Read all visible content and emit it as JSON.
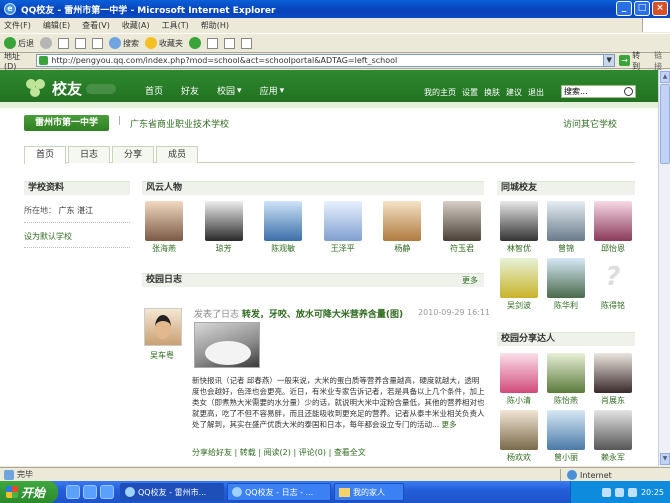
{
  "window": {
    "title": "QQ校友 - 雷州市第一中学 - Microsoft Internet Explorer",
    "menu": [
      "文件(F)",
      "编辑(E)",
      "查看(V)",
      "收藏(A)",
      "工具(T)",
      "帮助(H)"
    ],
    "toolbar": {
      "back": "后退",
      "search": "搜索",
      "favorites": "收藏夹"
    },
    "address_label": "地址(D)",
    "address_value": "http://pengyou.qq.com/index.php?mod=school&act=schoolportal&ADTAG=left_school",
    "go_label": "转到",
    "links_label": "链接"
  },
  "site": {
    "logo": "校友",
    "nav": [
      "首页",
      "好友",
      "校园",
      "应用"
    ],
    "user_links": [
      "我的主页",
      "设置",
      "换肤",
      "建议",
      "退出"
    ],
    "search_placeholder": "搜索..."
  },
  "school": {
    "name": "雷州市第一中学",
    "other": "广东省商业职业技术学校",
    "visit_other": "访问其它学校"
  },
  "tabs": [
    "首页",
    "日志",
    "分享",
    "成员"
  ],
  "school_info": {
    "title": "学校资料",
    "location_label": "所在地：",
    "location": "广东 湛江",
    "set_default": "设为默认学校"
  },
  "people": {
    "title": "风云人物",
    "items": [
      "张海燕",
      "琼芳",
      "陈观敏",
      "王泽平",
      "杨静",
      "符玉君"
    ]
  },
  "blog": {
    "title": "校园日志",
    "more": "更多",
    "author": "吴车粤",
    "action": "发表了日志",
    "post_title": "转发，牙咬、放水可降大米营养含量(图)",
    "time": "2010-09-29 16:11",
    "text": "新快报讯（记者 邱春燕）一般来说，大米的蛋白质等营养含量越高，硬度就越大，透明度也会越好，色泽也会更亮。近日，有米业专家告诉记者，若是具备以上几个条件，加上类女（即煮熟大米需要的水分量）少的话，就说明大米中淀粉含量低，其他的营养相对也就更高，吃了不但不容易胖，而且还能吸收到更充足的营养。记者从泰丰米业相关负责人处了解到，其实在盛产优质大米的泰国和日本，每年都会设立专门的活动...",
    "text_more": "更多",
    "actions": [
      "分享给好友",
      "转载",
      "阅读(2)",
      "评论(0)",
      "查看全文"
    ]
  },
  "friends": {
    "title": "同城校友",
    "items": [
      "林智优",
      "曾锦",
      "邱怡恩",
      "吴剑波",
      "陈华利",
      "陈得铭"
    ]
  },
  "sharers": {
    "title": "校园分享达人",
    "items": [
      "陈小清",
      "陈怡燕",
      "肖展东",
      "杨欢欢",
      "曾小丽",
      "赖永军"
    ]
  },
  "status": {
    "text": "完毕",
    "zone": "Internet"
  },
  "taskbar": {
    "start": "开始",
    "tasks": [
      "QQ校友 - 雷州市...",
      "QQ校友 - 日志 - ...",
      "我的家人"
    ],
    "time": "20:25"
  },
  "colors": {
    "brand_green": "#2f7f24",
    "title_blue": "#0a4cc6"
  }
}
